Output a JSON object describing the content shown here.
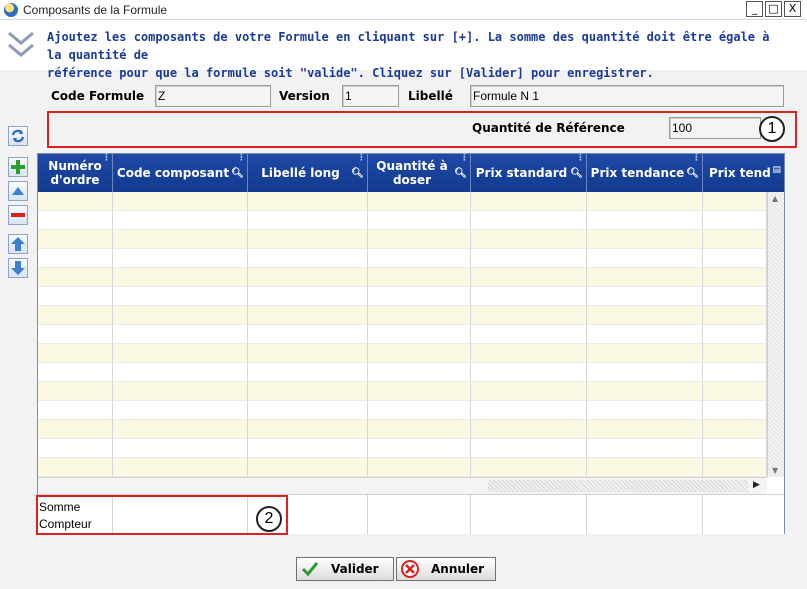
{
  "window": {
    "title": "Composants de la Formule",
    "controls": [
      "_",
      "□",
      "X"
    ]
  },
  "info": {
    "lines": [
      "Ajoutez les composants de votre Formule en cliquant sur [+]. La somme des quantité doit être égale à la quantité de",
      "référence pour que la formule soit \"valide\". Cliquez sur [Valider] pour enregistrer."
    ],
    "color": "#1a3a9a"
  },
  "form": {
    "code_label": "Code Formule",
    "code_value": "Z",
    "version_label": "Version",
    "version_value": "1",
    "libelle_label": "Libellé",
    "libelle_value": "Formule N 1",
    "qte_label": "Quantité  de Référence",
    "qte_value": "100"
  },
  "callouts": [
    "1",
    "2"
  ],
  "grid": {
    "columns": [
      {
        "line1": "Numéro",
        "line2": "d'ordre",
        "search": false
      },
      {
        "line1": "Code composant",
        "line2": "",
        "search": true
      },
      {
        "line1": "Libellé long",
        "line2": "",
        "search": true
      },
      {
        "line1": "Quantité à",
        "line2": "doser",
        "search": true
      },
      {
        "line1": "Prix standard",
        "line2": "",
        "search": true
      },
      {
        "line1": "Prix tendance",
        "line2": "",
        "search": true
      },
      {
        "line1": "Prix tend",
        "line2": "",
        "search": false
      }
    ],
    "footer": {
      "somme_label": "Somme",
      "compteur_label": "Compteur"
    },
    "header_color": "#1f49a6",
    "alt_row_color": "#fbf8e2"
  },
  "buttons": {
    "valider": "Valider",
    "annuler": "Annuler"
  },
  "accent": {
    "red": "#e02020",
    "green": "#2e9b2e"
  }
}
